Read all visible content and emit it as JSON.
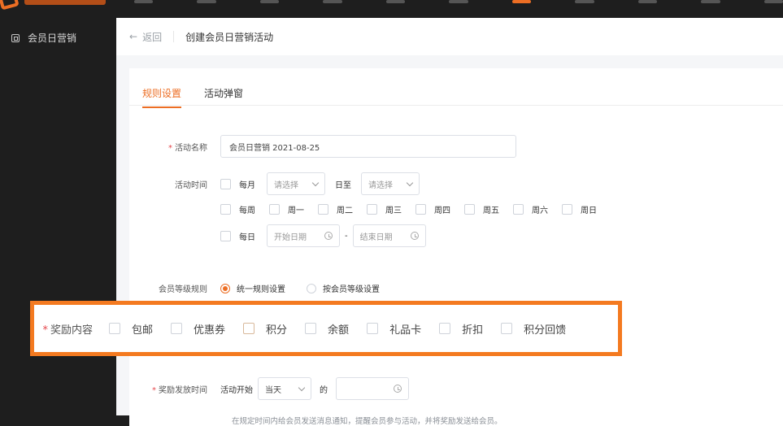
{
  "topbar": {
    "brand_colors": {
      "accent": "#ec6e24"
    }
  },
  "sidebar": {
    "items": [
      {
        "label": "会员日营销",
        "icon": "calendar-icon"
      }
    ]
  },
  "breadcrumb": {
    "back_label": "返回",
    "title": "创建会员日营销活动"
  },
  "tabs": [
    {
      "label": "规则设置",
      "active": true
    },
    {
      "label": "活动弹窗",
      "active": false
    }
  ],
  "form": {
    "name": {
      "label": "活动名称",
      "value": "会员日营销  2021-08-25"
    },
    "time": {
      "label": "活动时间",
      "monthly": {
        "label": "每月",
        "from_placeholder": "请选择",
        "to_label": "日至",
        "to_placeholder": "请选择"
      },
      "weekly": {
        "label": "每周",
        "days": [
          "周一",
          "周二",
          "周三",
          "周四",
          "周五",
          "周六",
          "周日"
        ]
      },
      "daily": {
        "label": "每日",
        "start_placeholder": "开始日期",
        "dash": "-",
        "end_placeholder": "结束日期"
      }
    },
    "level": {
      "label": "会员等级规则",
      "options": [
        {
          "label": "统一规则设置",
          "selected": true
        },
        {
          "label": "按会员等级设置",
          "selected": false
        }
      ]
    },
    "reward": {
      "label": "奖励内容",
      "options": [
        "包邮",
        "优惠券",
        "积分",
        "余额",
        "礼品卡",
        "折扣",
        "积分回馈"
      ]
    },
    "issue": {
      "label": "奖励发放时间",
      "prefix": "活动开始",
      "when": "当天",
      "of": "的",
      "hint": "在规定时间内给会员发送消息通知，提醒会员参与活动，并将奖励发送给会员。"
    }
  }
}
